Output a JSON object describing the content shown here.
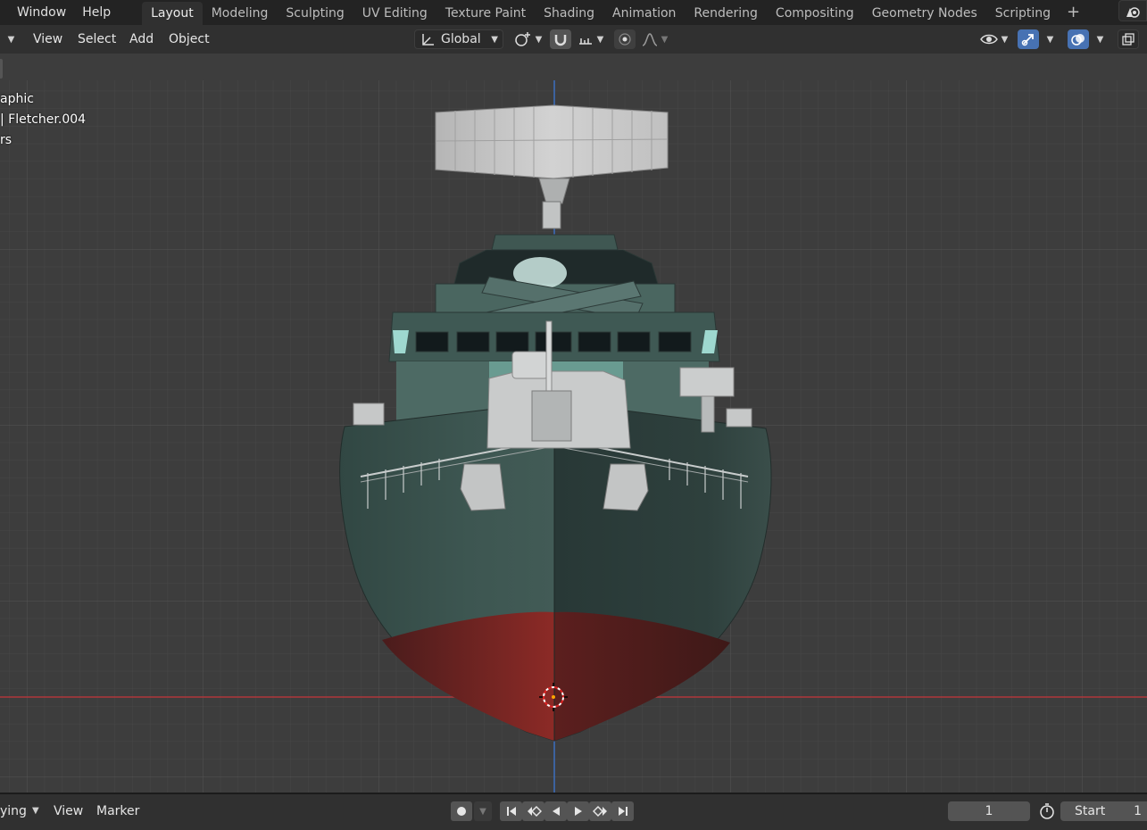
{
  "topbar": {
    "menu": [
      "Window",
      "Help"
    ],
    "workspaces": [
      "Layout",
      "Modeling",
      "Sculpting",
      "UV Editing",
      "Texture Paint",
      "Shading",
      "Animation",
      "Rendering",
      "Compositing",
      "Geometry Nodes",
      "Scripting"
    ],
    "active_workspace": "Layout",
    "add_workspace": "+"
  },
  "viewport_header": {
    "menus": [
      "View",
      "Select",
      "Add",
      "Object"
    ],
    "transform_orientation": "Global"
  },
  "viewport_overlay": {
    "line1": "aphic",
    "line2": "| Fletcher.004",
    "line3": "rs"
  },
  "timeline": {
    "playback_cut": "ying",
    "menus": [
      "View",
      "Marker"
    ],
    "current_frame": "1",
    "start_label": "Start",
    "start_value": "1"
  },
  "colors": {
    "accent_blue": "#4772b3",
    "x_axis_red": "#b0373b",
    "z_axis_blue": "#3c6fbf",
    "hull_green": "#3c5550",
    "hull_red": "#7a2422"
  },
  "icons": {
    "transform": "transform-orientation-icon",
    "pivot": "pivot-point-icon",
    "snap": "snap-magnet-icon",
    "snap_increment": "snap-increment-icon",
    "proportional": "proportional-editing-icon",
    "falloff": "falloff-curve-icon",
    "visibility": "visibility-eye-icon",
    "gizmo": "gizmo-arrow-icon",
    "overlay": "overlay-circles-icon",
    "xray": "xray-toggle-icon",
    "auto_key": "auto-keying-record-icon",
    "jump_start": "jump-to-start-icon",
    "prev_keyframe": "previous-keyframe-icon",
    "play_reverse": "play-reverse-icon",
    "play": "play-icon",
    "next_keyframe": "next-keyframe-icon",
    "jump_end": "jump-to-end-icon",
    "stopwatch": "stopwatch-icon",
    "cursor": "3d-cursor-icon"
  }
}
